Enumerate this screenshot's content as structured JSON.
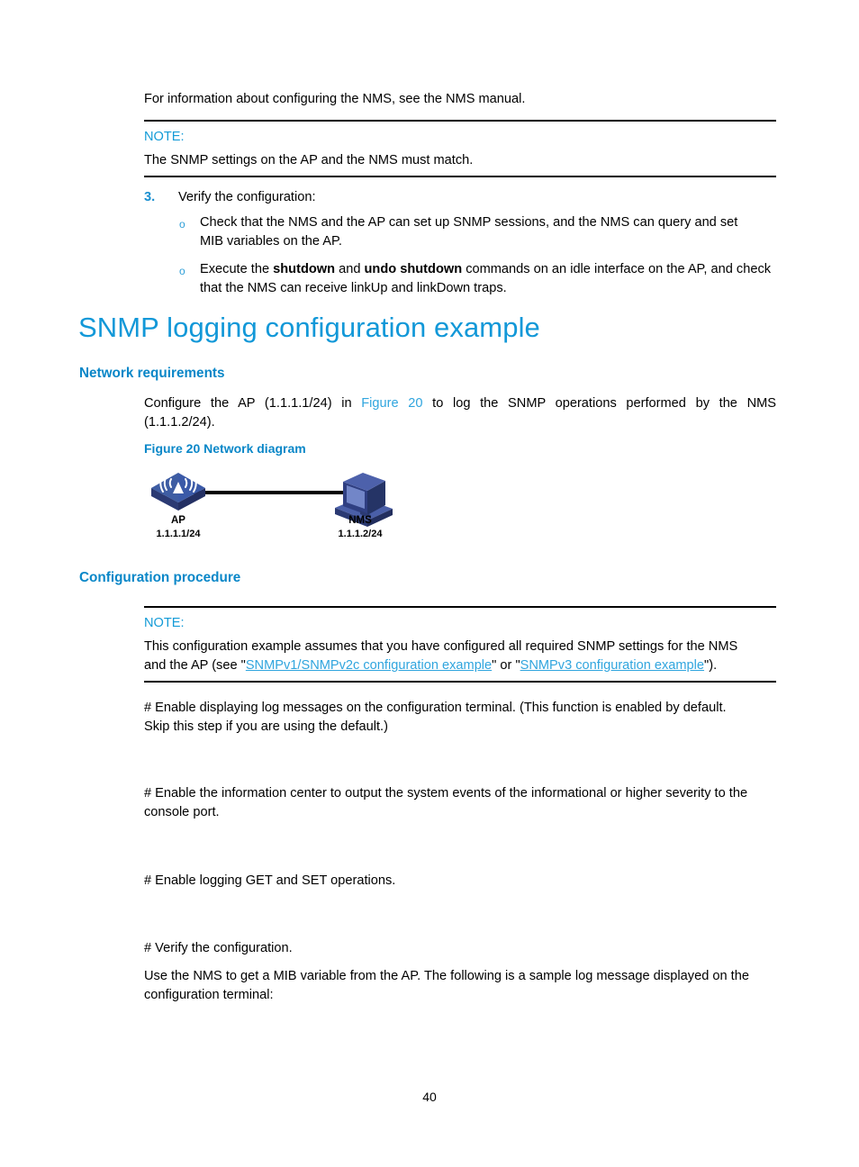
{
  "document": {
    "page_number": "40"
  },
  "intro": {
    "text": "For information about configuring the NMS, see the NMS manual."
  },
  "note1": {
    "label": "NOTE:",
    "text": "The SNMP settings on the AP and the NMS must match."
  },
  "step3": {
    "number": "3.",
    "text": "Verify the configuration:",
    "bullet_marker": "o",
    "items": [
      {
        "pre": "Check that the NMS and the AP can set up SNMP sessions, and the NMS can query and set MIB variables on the AP.",
        "line1": "Check that the NMS and the AP can set up SNMP sessions, and the NMS can query and set",
        "line2": "MIB variables on the AP."
      },
      {
        "l1_a": "Execute the ",
        "l1_b": "shutdown",
        "l1_c": " and ",
        "l1_d": "undo shutdown",
        "l1_e": " commands on an idle interface on the AP, and check",
        "line2": "that the NMS can receive linkUp and linkDown traps."
      }
    ]
  },
  "heading": {
    "title": "SNMP logging configuration example"
  },
  "network_requirements": {
    "heading": "Network requirements",
    "line1_a": "Configure the AP (1.1.1.1/24) in ",
    "line1_link": "Figure 20",
    "line1_b": " to log the SNMP operations performed by the NMS",
    "line2": "(1.1.1.2/24)."
  },
  "figure": {
    "caption": "Figure 20 Network diagram",
    "ap": {
      "label": "AP",
      "ip": "1.1.1.1/24",
      "icon": "wireless-access-point-icon"
    },
    "nms": {
      "label": "NMS",
      "ip": "1.1.1.2/24",
      "icon": "computer-workstation-icon"
    },
    "link_icon": "network-link-line"
  },
  "configuration_procedure": {
    "heading": "Configuration procedure"
  },
  "note2": {
    "label": "NOTE:",
    "line1": "This configuration example assumes that you have configured all required SNMP settings for the NMS",
    "line2_a": "and the AP (see \"",
    "line2_link1": "SNMPv1/SNMPv2c configuration example",
    "line2_b": "\" or \"",
    "line2_link2": "SNMPv3 configuration example",
    "line2_c": "\")."
  },
  "body": {
    "p1_line1": "# Enable displaying log messages on the configuration terminal. (This function is enabled by default.",
    "p1_line2": "Skip this step if you are using the default.)",
    "p2_line1": "# Enable the information center to output the system events of the informational or higher severity to the",
    "p2_line2": "console port.",
    "p3": "# Enable logging GET and SET operations.",
    "p4": "# Verify the configuration.",
    "p5_line1": "Use the NMS to get a MIB variable from the AP. The following is a sample log message displayed on the",
    "p5_line2": "configuration terminal:"
  },
  "colors": {
    "heading_blue": "#1298d8",
    "subheading_blue": "#0a87c8",
    "link_blue": "#30a5de",
    "note_label_blue": "#149bd7",
    "step_num_blue": "#1a8fd0",
    "icon_blue_top": "#3b5aa8",
    "icon_blue_side": "#2e3f7e",
    "icon_blue_light": "#6b7fc4"
  }
}
